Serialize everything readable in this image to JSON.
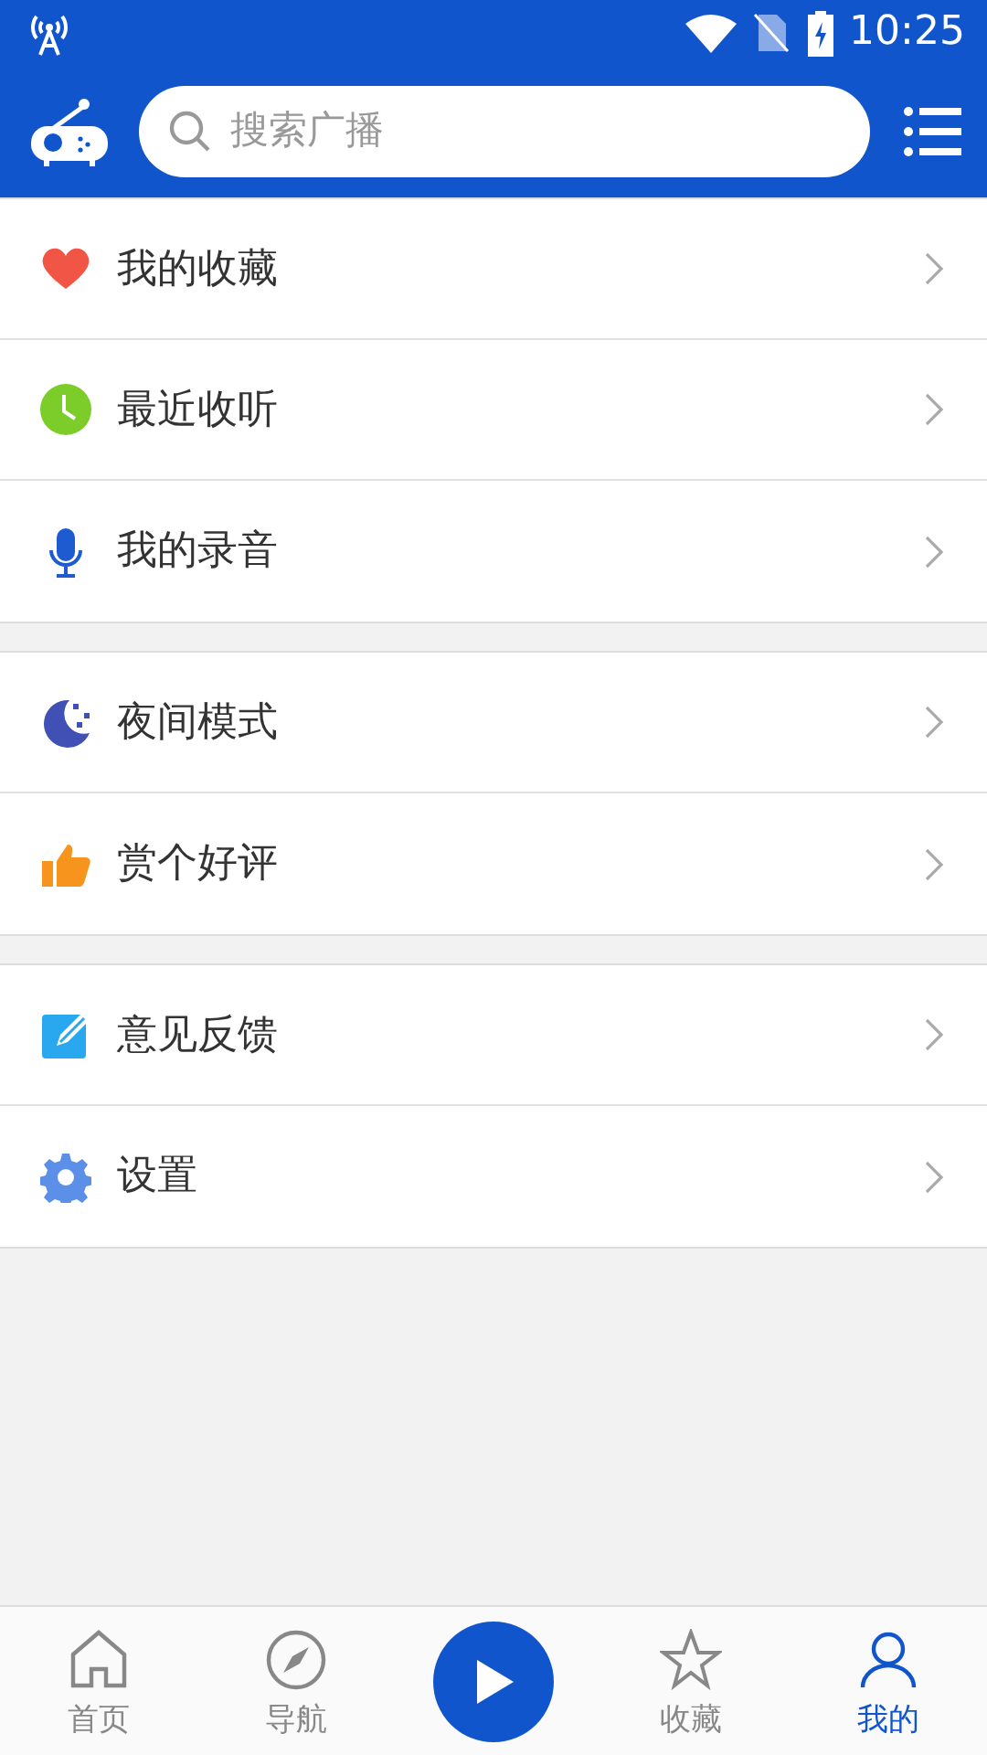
{
  "status_bar": {
    "time": "10:25"
  },
  "search": {
    "placeholder": "搜索广播"
  },
  "menu_groups": [
    {
      "items": [
        {
          "kind": "heart",
          "label": "我的收藏"
        },
        {
          "kind": "clock",
          "label": "最近收听"
        },
        {
          "kind": "mic",
          "label": "我的录音"
        }
      ]
    },
    {
      "items": [
        {
          "kind": "moon",
          "label": "夜间模式"
        },
        {
          "kind": "thumb",
          "label": "赏个好评"
        }
      ]
    },
    {
      "items": [
        {
          "kind": "edit",
          "label": "意见反馈"
        },
        {
          "kind": "gear",
          "label": "设置"
        }
      ]
    }
  ],
  "bottom_nav": [
    {
      "kind": "home",
      "label": "首页",
      "selected": false
    },
    {
      "kind": "compass",
      "label": "导航",
      "selected": false
    },
    {
      "kind": "play"
    },
    {
      "kind": "star",
      "label": "收藏",
      "selected": false
    },
    {
      "kind": "person",
      "label": "我的",
      "selected": true
    }
  ]
}
